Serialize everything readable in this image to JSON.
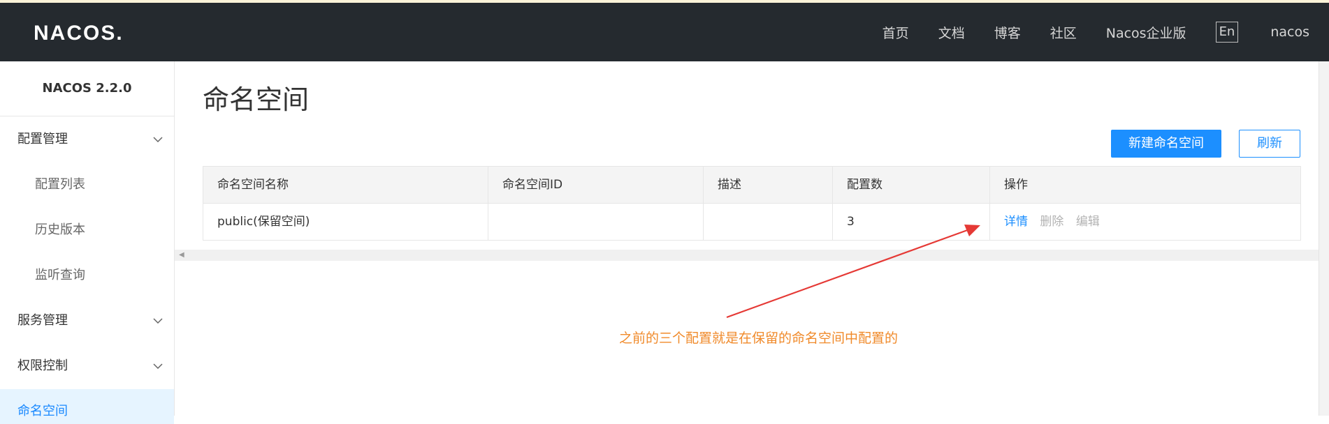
{
  "header": {
    "logo": "NACOS.",
    "nav": [
      "首页",
      "文档",
      "博客",
      "社区",
      "Nacos企业版"
    ],
    "lang": "En",
    "user": "nacos"
  },
  "sidebar": {
    "version": "NACOS 2.2.0",
    "groups": [
      {
        "label": "配置管理",
        "items": [
          "配置列表",
          "历史版本",
          "监听查询"
        ]
      },
      {
        "label": "服务管理"
      },
      {
        "label": "权限控制"
      }
    ],
    "active": "命名空间"
  },
  "main": {
    "title": "命名空间",
    "buttons": {
      "create": "新建命名空间",
      "refresh": "刷新"
    },
    "table": {
      "columns": [
        "命名空间名称",
        "命名空间ID",
        "描述",
        "配置数",
        "操作"
      ],
      "rows": [
        {
          "name": "public(保留空间)",
          "id": "",
          "desc": "",
          "count": "3",
          "actions": [
            "详情",
            "删除",
            "编辑"
          ]
        }
      ]
    }
  },
  "annotation": "之前的三个配置就是在保留的命名空间中配置的",
  "colors": {
    "topbar": "#252a2f",
    "primary": "#1c8fff",
    "annotation": "#f08a2a",
    "arrow": "#e53935"
  }
}
